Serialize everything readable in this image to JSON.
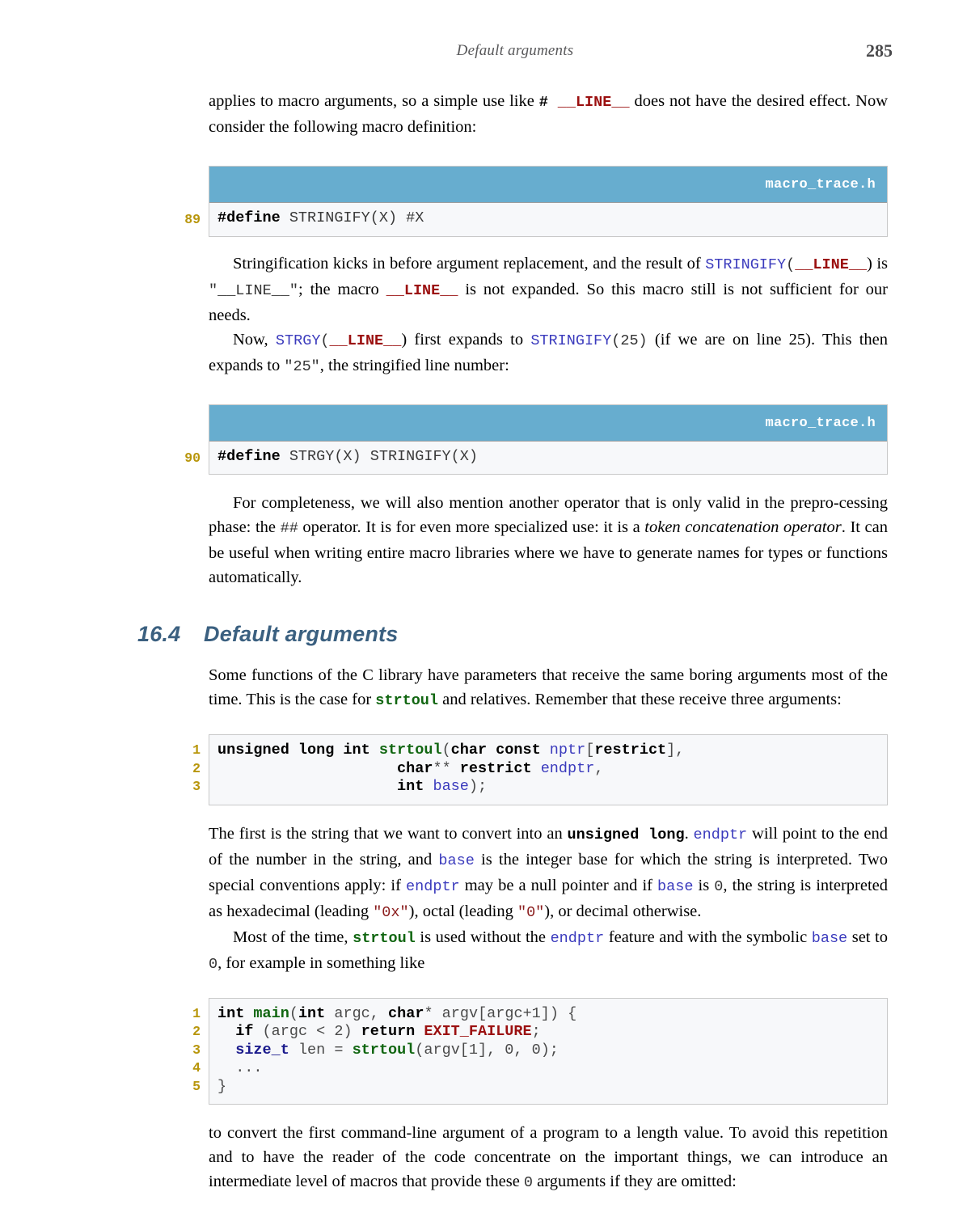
{
  "header": {
    "running_title": "Default arguments",
    "page_number": "285"
  },
  "colors": {
    "code_header_bg": "#67adcf",
    "code_bg": "#f7f8fa",
    "line_number": "#b8960c",
    "heading": "#3b6080",
    "macro_red": "#9b1010",
    "identifier_blue": "#3b3bbd",
    "function_green": "#116611"
  },
  "paragraphs": {
    "p1_a": "applies to macro arguments, so a simple use like ",
    "p1_hash": "#",
    "p1_line": "__LINE__",
    "p1_b": " does not have the desired effect. Now consider the following macro definition:",
    "p2_a": "Stringification kicks in before argument replacement, and the result of ",
    "p2_stringify": "STRINGIFY",
    "p2_paren_open": "(",
    "p2_line1": "__LINE__",
    "p2_b": ") is ",
    "p2_quoted_line": "\"__LINE__\"",
    "p2_c": "; the macro ",
    "p2_line2": "__LINE__",
    "p2_d": " is not expanded. So this macro still is not sufficient for our needs.",
    "p3_a": "Now, ",
    "p3_strgy": "STRGY",
    "p3_open": "(",
    "p3_line": "__LINE__",
    "p3_b": ") first expands to ",
    "p3_stringify": "STRINGIFY",
    "p3_arg": "(25)",
    "p3_c": " (if we are on line 25). This then expands to ",
    "p3_quoted25": "\"25\"",
    "p3_d": ", the stringified line number:",
    "p4_a": "For completeness, we will also mention another operator that is only valid in the prepro-cessing phase: the ",
    "p4_hashhash": "##",
    "p4_b": " operator. It is for even more specialized use: it is a ",
    "p4_italic": "token concatenation operator",
    "p4_c": ". It can be useful when writing entire macro libraries where we have to generate names for types or functions automatically.",
    "p5_a": "Some functions of the C library have parameters that receive the same boring arguments most of the time. This is the case for ",
    "p5_strtoul": "strtoul",
    "p5_b": " and relatives. Remember that these receive three arguments:",
    "p6_a": "The first is the string that we want to convert into an ",
    "p6_unsigned_long": "unsigned long",
    "p6_b": ". ",
    "p6_endptr1": "endptr",
    "p6_c": " will point to the end of the number in the string, and ",
    "p6_base1": "base",
    "p6_d": " is the integer base for which the string is interpreted. Two special conventions apply: if ",
    "p6_endptr2": "endptr",
    "p6_e": " may be a null pointer and if ",
    "p6_base2": "base",
    "p6_f": " is ",
    "p6_zero": "0",
    "p6_g": ", the string is interpreted as hexadecimal (leading ",
    "p6_hex": "\"0x\"",
    "p6_h": "), octal (leading ",
    "p6_oct": "\"0\"",
    "p6_i": "), or decimal otherwise.",
    "p7_a": "Most of the time, ",
    "p7_strtoul": "strtoul",
    "p7_b": " is used without the ",
    "p7_endptr": "endptr",
    "p7_c": " feature and with the symbolic ",
    "p7_base": "base",
    "p7_d": " set to ",
    "p7_zero": "0",
    "p7_e": ", for example in something like",
    "p8_a": "to convert the first command-line argument of a program to a length value. To avoid this repetition and to have the reader of the code concentrate on the important things, we can introduce an intermediate level of macros that provide these ",
    "p8_zero": "0",
    "p8_b": " arguments if they are omitted:"
  },
  "section": {
    "number": "16.4",
    "title": "Default arguments"
  },
  "listing1": {
    "filename": "macro_trace.h",
    "line_numbers": [
      "89"
    ],
    "code": {
      "kw": "#define",
      "rest": " STRINGIFY(X) #X"
    }
  },
  "listing2": {
    "filename": "macro_trace.h",
    "line_numbers": [
      "90"
    ],
    "code": {
      "kw": "#define",
      "rest": " STRGY(X) STRINGIFY(X)"
    }
  },
  "listing3": {
    "line_numbers": [
      "1",
      "2",
      "3"
    ],
    "rows": [
      {
        "segments": [
          {
            "t": "unsigned long int ",
            "c": "m-black"
          },
          {
            "t": "strtoul",
            "c": "m-green"
          },
          {
            "t": "(",
            "c": "m-plain"
          },
          {
            "t": "char const ",
            "c": "m-black"
          },
          {
            "t": "nptr",
            "c": "m-blue"
          },
          {
            "t": "[",
            "c": "m-plain"
          },
          {
            "t": "restrict",
            "c": "m-black"
          },
          {
            "t": "],",
            "c": "m-plain"
          }
        ]
      },
      {
        "segments": [
          {
            "t": "                    ",
            "c": "m-plain"
          },
          {
            "t": "char",
            "c": "m-black"
          },
          {
            "t": "** ",
            "c": "m-plain"
          },
          {
            "t": "restrict ",
            "c": "m-black"
          },
          {
            "t": "endptr",
            "c": "m-blue"
          },
          {
            "t": ",",
            "c": "m-plain"
          }
        ]
      },
      {
        "segments": [
          {
            "t": "                    ",
            "c": "m-plain"
          },
          {
            "t": "int ",
            "c": "m-black"
          },
          {
            "t": "base",
            "c": "m-blue"
          },
          {
            "t": ");",
            "c": "m-plain"
          }
        ]
      }
    ]
  },
  "listing4": {
    "line_numbers": [
      "1",
      "2",
      "3",
      "4",
      "5"
    ],
    "rows": [
      {
        "segments": [
          {
            "t": "int ",
            "c": "m-black"
          },
          {
            "t": "main",
            "c": "m-green"
          },
          {
            "t": "(",
            "c": "m-plain"
          },
          {
            "t": "int ",
            "c": "m-black"
          },
          {
            "t": "argc",
            "c": "m-plain"
          },
          {
            "t": ", ",
            "c": "m-plain"
          },
          {
            "t": "char",
            "c": "m-black"
          },
          {
            "t": "* ",
            "c": "m-plain"
          },
          {
            "t": "argv[argc+1]) {",
            "c": "m-plain"
          }
        ]
      },
      {
        "segments": [
          {
            "t": "  ",
            "c": "m-plain"
          },
          {
            "t": "if ",
            "c": "m-black"
          },
          {
            "t": "(argc < 2) ",
            "c": "m-plain"
          },
          {
            "t": "return ",
            "c": "m-black"
          },
          {
            "t": "EXIT_FAILURE",
            "c": "m-red"
          },
          {
            "t": ";",
            "c": "m-plain"
          }
        ]
      },
      {
        "segments": [
          {
            "t": "  ",
            "c": "m-plain"
          },
          {
            "t": "size_t ",
            "c": "m-navy"
          },
          {
            "t": "len = ",
            "c": "m-plain"
          },
          {
            "t": "strtoul",
            "c": "m-green"
          },
          {
            "t": "(argv[1], 0, 0);",
            "c": "m-plain"
          }
        ]
      },
      {
        "segments": [
          {
            "t": "  ...",
            "c": "m-plain"
          }
        ]
      },
      {
        "segments": [
          {
            "t": "}",
            "c": "m-plain"
          }
        ]
      }
    ]
  }
}
